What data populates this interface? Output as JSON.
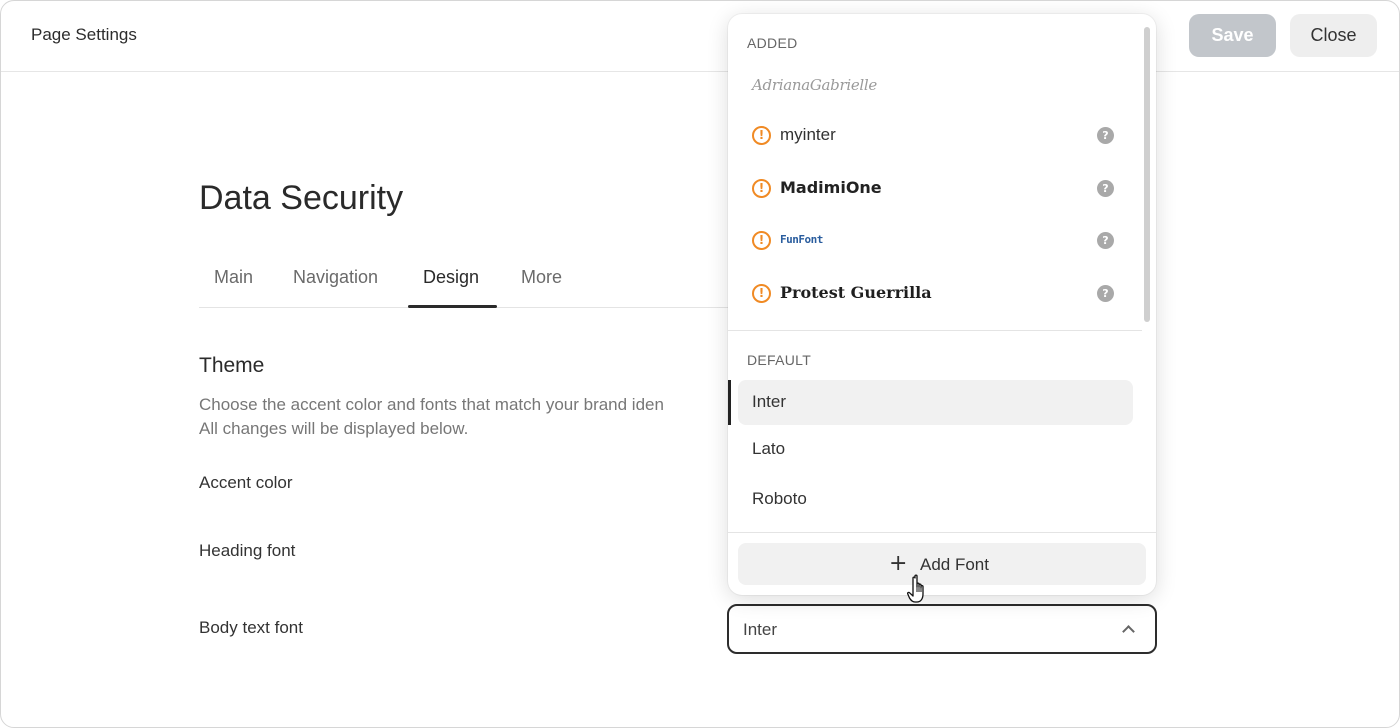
{
  "topbar": {
    "title": "Page Settings",
    "save_label": "Save",
    "close_label": "Close"
  },
  "page": {
    "title": "Data Security"
  },
  "tabs": [
    {
      "label": "Main"
    },
    {
      "label": "Navigation"
    },
    {
      "label": "Design"
    },
    {
      "label": "More"
    }
  ],
  "active_tab": "Design",
  "theme": {
    "title": "Theme",
    "desc_line1": "Choose the accent color and fonts that match your brand iden",
    "desc_line2": "All changes will be displayed below.",
    "accent_label": "Accent color",
    "heading_font_label": "Heading font",
    "body_font_label": "Body text font",
    "body_font_value": "Inter"
  },
  "dropdown": {
    "added_label": "ADDED",
    "default_label": "DEFAULT",
    "added_items": [
      {
        "label": "AdrianaGabrielle",
        "warning": false
      },
      {
        "label": "myinter",
        "warning": true
      },
      {
        "label": "MadimiOne",
        "warning": true
      },
      {
        "label": "FunFont",
        "warning": true
      },
      {
        "label": "Protest Guerrilla",
        "warning": true
      }
    ],
    "default_items": [
      {
        "label": "Inter",
        "selected": true
      },
      {
        "label": "Lato",
        "selected": false
      },
      {
        "label": "Roboto",
        "selected": false
      }
    ],
    "add_font_label": "Add Font"
  },
  "icons": {
    "warning": "warning-circle-icon",
    "help": "help-circle-icon",
    "plus": "plus-icon",
    "chevron": "chevron-up-icon",
    "cursor": "hand-pointer-cursor"
  },
  "colors": {
    "warning": "#f08a24",
    "save_disabled": "#c2c6cb",
    "text_primary": "#2b2b2b"
  }
}
